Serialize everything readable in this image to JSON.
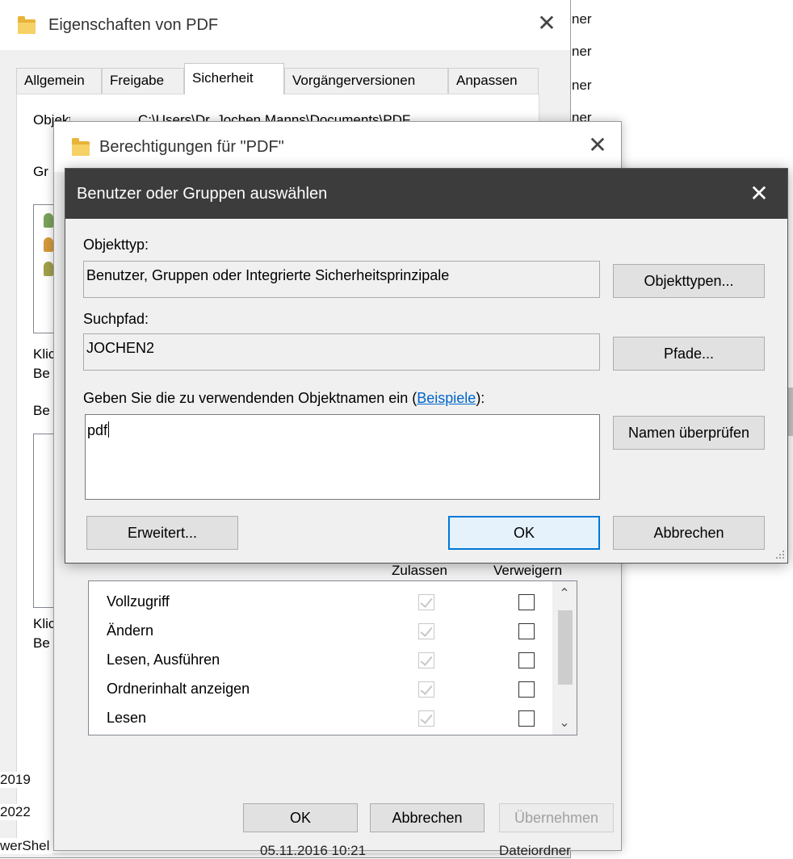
{
  "background": {
    "right_fragments": [
      "ner",
      "ner",
      "ner",
      "ner"
    ],
    "left_fragments": [
      "2019",
      "2022",
      "werShel"
    ],
    "bottom_status": [
      "05.11.2016 10:21",
      "Dateiordner"
    ]
  },
  "properties_window": {
    "title": "Eigenschaften von PDF",
    "close_symbol": "✕",
    "tabs": [
      {
        "label": "Allgemein"
      },
      {
        "label": "Freigabe"
      },
      {
        "label": "Sicherheit"
      },
      {
        "label": "Vorgängerversionen"
      },
      {
        "label": "Anpassen"
      }
    ],
    "active_tab": "Sicherheit",
    "object_name_label": "Objektname:",
    "object_name_value": "C:\\Users\\Dr. Jochen Manns\\Documents\\PDF",
    "fragments": [
      "Gr",
      "Klic",
      "Be",
      "Be",
      "Klic",
      "Be"
    ]
  },
  "permissions_window": {
    "title": "Berechtigungen für \"PDF\"",
    "close_symbol": "✕",
    "col_allow": "Zulassen",
    "col_deny": "Verweigern",
    "rows": [
      {
        "name": "Vollzugriff",
        "allow": true,
        "deny": false
      },
      {
        "name": "Ändern",
        "allow": true,
        "deny": false
      },
      {
        "name": "Lesen, Ausführen",
        "allow": true,
        "deny": false
      },
      {
        "name": "Ordnerinhalt anzeigen",
        "allow": true,
        "deny": false
      },
      {
        "name": "Lesen",
        "allow": true,
        "deny": false
      }
    ],
    "scroll_up": "⌃",
    "scroll_down": "⌄",
    "buttons": {
      "ok": "OK",
      "cancel": "Abbrechen",
      "apply": "Übernehmen"
    }
  },
  "select_dialog": {
    "title": "Benutzer oder Gruppen auswählen",
    "close_symbol": "✕",
    "object_type_label": "Objekttyp:",
    "object_type_value": "Benutzer, Gruppen oder Integrierte Sicherheitsprinzipale",
    "object_types_button": "Objekttypen...",
    "search_path_label": "Suchpfad:",
    "search_path_value": "JOCHEN2",
    "paths_button": "Pfade...",
    "enter_names_label_prefix": "Geben Sie die zu verwendenden Objektnamen ein (",
    "examples_link": "Beispiele",
    "enter_names_label_suffix": "):",
    "names_value": "pdf",
    "check_names_button": "Namen überprüfen",
    "advanced_button": "Erweitert...",
    "ok_button": "OK",
    "cancel_button": "Abbrechen"
  },
  "colors": {
    "dialog_titlebar": "#3c3c3c",
    "default_button_border": "#0078d7",
    "link": "#0066cc",
    "folder": "#e8b339"
  }
}
